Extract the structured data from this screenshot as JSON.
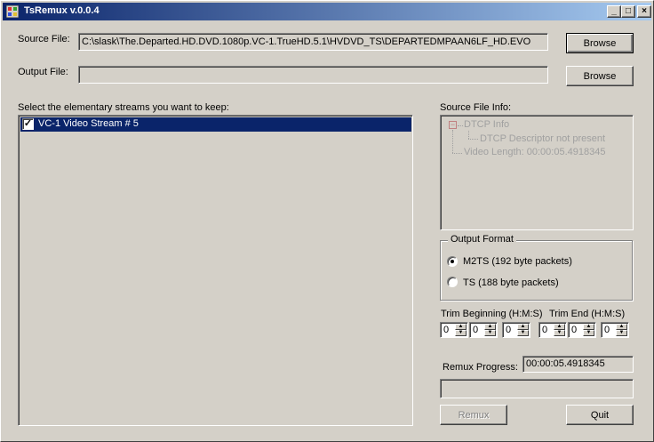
{
  "window": {
    "title": "TsRemux v.0.0.4"
  },
  "controls": {
    "minimize": "_",
    "maximize": "□",
    "close": "×"
  },
  "source": {
    "label": "Source File:",
    "value": "C:\\slask\\The.Departed.HD.DVD.1080p.VC-1.TrueHD.5.1\\HVDVD_TS\\DEPARTEDMPAAN6LF_HD.EVO",
    "browse": "Browse"
  },
  "output": {
    "label": "Output File:",
    "value": "",
    "browse": "Browse"
  },
  "streams": {
    "label": "Select the elementary streams you want to keep:",
    "items": [
      {
        "label": "VC-1 Video Stream # 5",
        "checked": true
      }
    ]
  },
  "info": {
    "label": "Source File Info:",
    "tree": {
      "root": "DTCP Info",
      "child": "DTCP Descriptor not present",
      "sibling": "Video Length: 00:00:05.4918345"
    }
  },
  "format": {
    "legend": "Output Format",
    "options": [
      {
        "label": "M2TS (192 byte packets)",
        "selected": true
      },
      {
        "label": "TS (188 byte packets)",
        "selected": false
      }
    ]
  },
  "trim": {
    "begin_label": "Trim Beginning (H:M:S)",
    "end_label": "Trim End (H:M:S)",
    "begin": [
      "0",
      "0",
      "0"
    ],
    "end": [
      "0",
      "0",
      "0"
    ]
  },
  "progress": {
    "label": "Remux Progress:",
    "time": "00:00:05.4918345",
    "fraction": 0
  },
  "actions": {
    "remux": "Remux",
    "quit": "Quit"
  },
  "icons": {
    "checkmark": "✓",
    "expander": "−",
    "spin_up": "▲",
    "spin_down": "▼"
  },
  "colors": {
    "title_start": "#0a246a",
    "title_end": "#a6caf0",
    "selection": "#0a246a",
    "face": "#d4d0c8"
  }
}
